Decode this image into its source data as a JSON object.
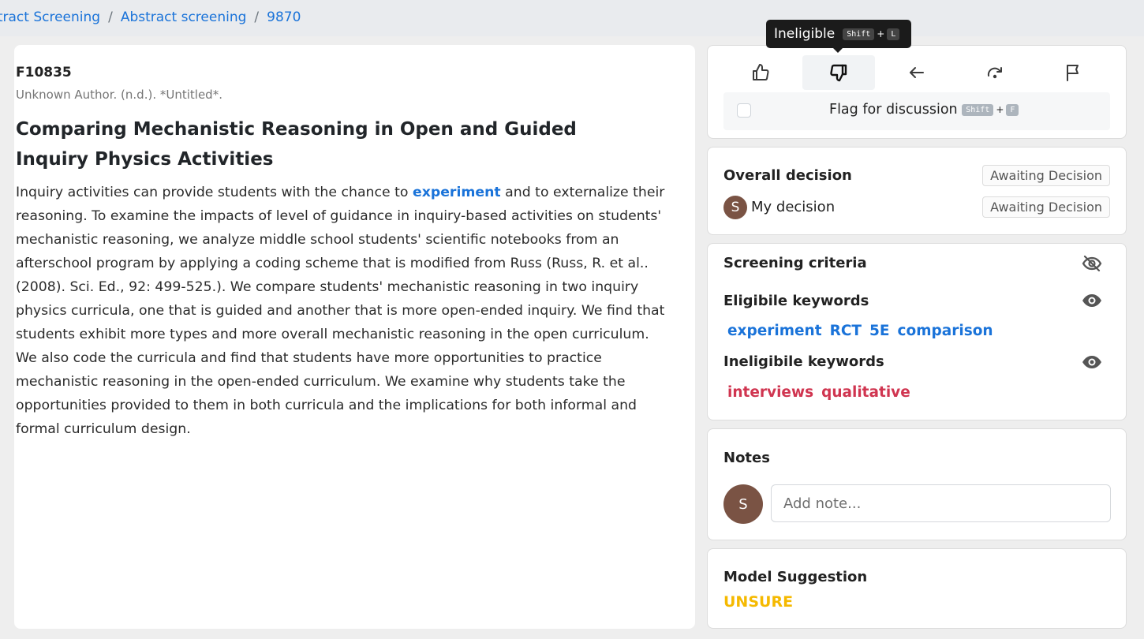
{
  "breadcrumb": {
    "items": [
      "stract Screening",
      "Abstract screening",
      "9870"
    ],
    "separator": "/"
  },
  "article": {
    "record_id": "F10835",
    "citation": "Unknown Author. (n.d.). *Untitled*.",
    "title": "Comparing Mechanistic Reasoning in Open and Guided Inquiry Physics Activities",
    "abstract_before": "Inquiry activities can provide students with the chance to ",
    "abstract_keyword": "experiment",
    "abstract_after": " and to externalize their reasoning. To examine the impacts of level of guidance in inquiry-based activities on students' mechanistic reasoning, we analyze middle school students' scientific notebooks from an afterschool program by applying a coding scheme that is modified from Russ (Russ, R. et al.. (2008). Sci. Ed., 92: 499-525.). We compare students' mechanistic reasoning in two inquiry physics curricula, one that is guided and another that is more open-ended inquiry. We find that students exhibit more types and more overall mechanistic reasoning in the open curriculum. We also code the curricula and find that students have more opportunities to practice mechanistic reasoning in the open-ended curriculum. We examine why students take the opportunities provided to them in both curricula and the implications for both informal and formal curriculum design."
  },
  "tooltip": {
    "label": "Ineligible",
    "key1": "Shift",
    "plus": "+",
    "key2": "L"
  },
  "actions": {
    "buttons": [
      {
        "name": "eligible",
        "icon": "thumbs-up-icon"
      },
      {
        "name": "ineligible",
        "icon": "thumbs-down-icon"
      },
      {
        "name": "back",
        "icon": "arrow-left-icon"
      },
      {
        "name": "skip",
        "icon": "redo-icon"
      },
      {
        "name": "flag",
        "icon": "flag-icon"
      }
    ],
    "flag_label": "Flag for discussion",
    "flag_key1": "Shift",
    "flag_plus": "+",
    "flag_key2": "F"
  },
  "decision": {
    "overall_label": "Overall decision",
    "overall_status": "Awaiting Decision",
    "my_label": "My decision",
    "my_status": "Awaiting Decision",
    "avatar_initial": "S"
  },
  "criteria": {
    "title": "Screening criteria",
    "eligible_title": "Eligibile keywords",
    "eligible_keywords": [
      "experiment",
      "RCT",
      "5E",
      "comparison"
    ],
    "ineligible_title": "Ineligibile keywords",
    "ineligible_keywords": [
      "interviews",
      "qualitative"
    ]
  },
  "notes": {
    "title": "Notes",
    "avatar_initial": "S",
    "placeholder": "Add note..."
  },
  "model": {
    "title": "Model Suggestion",
    "value": "UNSURE"
  },
  "colors": {
    "link": "#1a73d9",
    "eligible": "#1a73d9",
    "ineligible": "#d03550",
    "unsure": "#f5b900",
    "avatar": "#7a5344"
  }
}
